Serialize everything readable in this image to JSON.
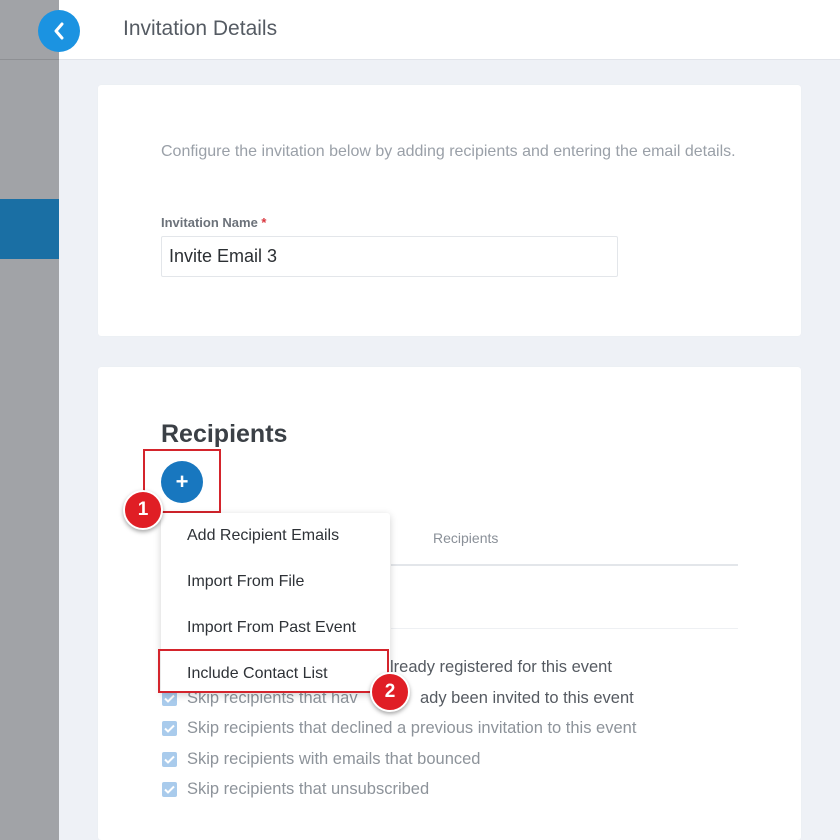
{
  "header": {
    "title": "Invitation Details"
  },
  "invitation": {
    "description": "Configure the invitation below by adding recipients and entering the email details.",
    "name_label": "Invitation Name",
    "required_mark": "*",
    "name_value": "Invite Email 3"
  },
  "recipients": {
    "title": "Recipients",
    "add_label": "+",
    "column_header": "Recipients",
    "menu": [
      "Add Recipient Emails",
      "Import From File",
      "Import From Past Event",
      "Include Contact List"
    ],
    "options": [
      {
        "fragment": "lready registered for this event",
        "checked": true
      },
      {
        "prefix": "Skip recipients that hav",
        "suffix": "ady been invited to this event",
        "checked": true
      },
      {
        "label": "Skip recipients that declined a previous invitation to this event",
        "checked": true
      },
      {
        "label": "Skip recipients with emails that bounced",
        "checked": true
      },
      {
        "label": "Skip recipients that unsubscribed",
        "checked": true
      }
    ]
  },
  "annotations": {
    "step1": "1",
    "step2": "2"
  },
  "colors": {
    "accent": "#1b93e1",
    "button": "#1877bf",
    "highlight": "#d4242c",
    "badge": "#e01e25"
  }
}
